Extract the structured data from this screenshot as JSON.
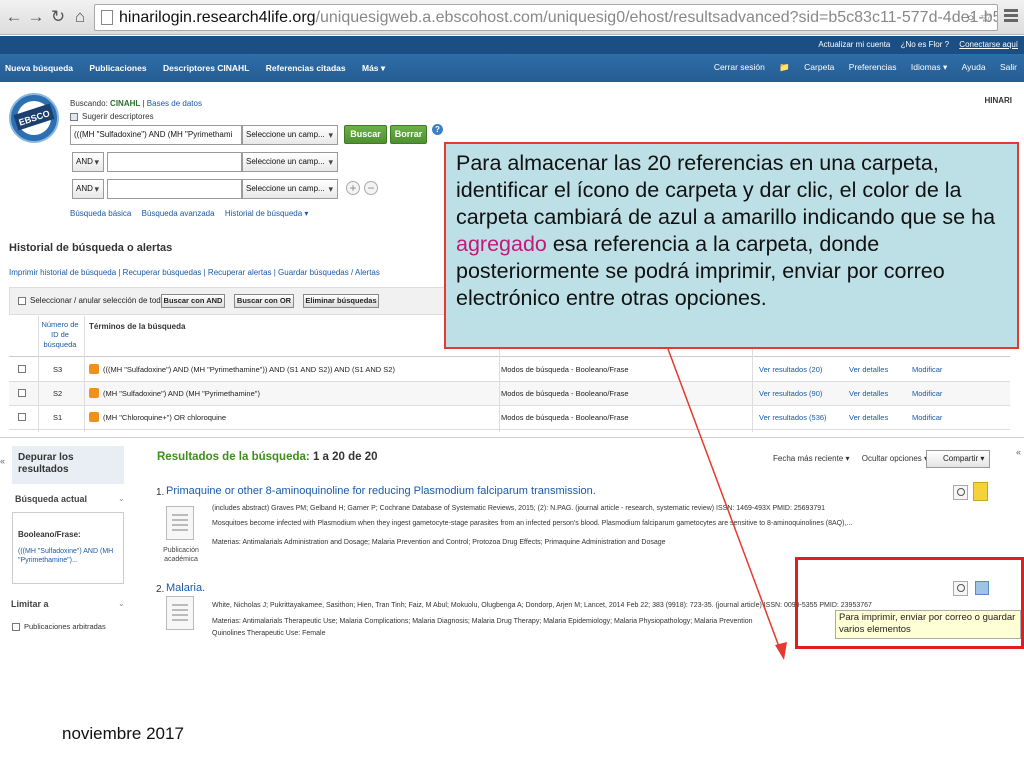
{
  "browser": {
    "url_host": "hinarilogin.research4life.org",
    "url_path": "/uniquesigweb.a.ebscohost.com/uniquesig0/ehost/resultsadvanced?sid=b5c83c11-577d-4de1-b5ca-078d830b3370%4...",
    "back_icon": "back-arrow-icon",
    "forward_icon": "forward-arrow-icon",
    "reload_icon": "reload-icon",
    "home_icon": "home-icon"
  },
  "topline": {
    "update_account": "Actualizar mi cuenta",
    "not_user": "¿No es Flor ?",
    "connect": "Conectarse aquí"
  },
  "nav": {
    "left": [
      "Nueva búsqueda",
      "Publicaciones",
      "Descriptores CINAHL",
      "Referencias citadas",
      "Más ▾"
    ],
    "right": [
      "Cerrar sesión",
      "Carpeta",
      "Preferencias",
      "Idiomas ▾",
      "Ayuda",
      "Salir"
    ]
  },
  "search": {
    "searching_label": "Buscando:",
    "database": "CINAHL",
    "databases_link": "Bases de datos",
    "suggest": "Sugerir descriptores",
    "row1_value": "(((MH \"Sulfadoxine\") AND (MH \"Pyrimethami",
    "field_select": "Seleccione un camp...",
    "bool_op": "AND",
    "search_button": "Buscar",
    "clear_button": "Borrar",
    "help": "?",
    "add": "+",
    "remove": "−",
    "links": [
      "Búsqueda básica",
      "Búsqueda avanzada",
      "Historial de búsqueda ▾"
    ],
    "hinari": "HINARI"
  },
  "history": {
    "title": "Historial de búsqueda o alertas",
    "links": "Imprimir historial de búsqueda | Recuperar búsquedas | Recuperar alertas | Guardar búsquedas / Alertas",
    "select_all": "Seleccionar / anular selección de todo",
    "btn_and": "Buscar con AND",
    "btn_or": "Buscar con OR",
    "btn_delete": "Eliminar búsquedas",
    "col_num": "Número de ID de búsqueda",
    "col_terms": "Términos de la búsqueda",
    "rows": [
      {
        "id": "S3",
        "query": "(((MH \"Sulfadoxine\") AND (MH \"Pyrimethamine\")) AND (S1 AND S2)) AND (S1 AND S2)",
        "mode": "Modos de búsqueda - Booleano/Frase",
        "results": "Ver resultados (20)",
        "details": "Ver detalles",
        "edit": "Modificar"
      },
      {
        "id": "S2",
        "query": "(MH \"Sulfadoxine\") AND (MH \"Pyrimethamine\")",
        "mode": "Modos de búsqueda - Booleano/Frase",
        "results": "Ver resultados (90)",
        "details": "Ver detalles",
        "edit": "Modificar"
      },
      {
        "id": "S1",
        "query": "(MH \"Chloroquine+\") OR chloroquine",
        "mode": "Modos de búsqueda - Booleano/Frase",
        "results": "Ver resultados (536)",
        "details": "Ver detalles",
        "edit": "Modificar"
      }
    ]
  },
  "sidebar": {
    "refine": "Depurar los resultados",
    "current": "Búsqueda actual",
    "bool_label": "Booleano/Frase:",
    "bool_value": "(((MH \"Sulfadoxine\") AND (MH \"Pyrimethamine\")...",
    "limit": "Limitar a",
    "peer": "Publicaciones arbitradas"
  },
  "results": {
    "title_label": "Resultados de la búsqueda:",
    "count": "1 a 20 de 20",
    "sort": "Fecha más reciente ▾",
    "hide": "Ocultar opciones ▾",
    "share": "Compartir ▾",
    "items": [
      {
        "num": "1.",
        "title": "Primaquine or other 8-aminoquinoline for reducing Plasmodium falciparum transmission.",
        "line1": "(includes abstract) Graves PM; Gelband H; Garner P; Cochrane Database of Systematic Reviews, 2015; (2): N.PAG. (journal article - research, systematic review) ISSN: 1469-493X PMID: 25693791",
        "line2": "Mosquitoes become infected with Plasmodium when they ingest gametocyte-stage parasites from an infected person's blood. Plasmodium falciparum gametocytes are sensitive to 8-aminoquinolines (8AQ),...",
        "line3": "Materias: Antimalarials Administration and Dosage; Malaria Prevention and Control; Protozoa Drug Effects; Primaquine Administration and Dosage",
        "pubtype": "Publicación académica"
      },
      {
        "num": "2.",
        "title": "Malaria.",
        "line1": "White, Nicholas J; Pukrittayakamee, Sasithon; Hien, Tran Tinh; Faiz, M Abul; Mokuolu, Olugbenga A; Dondorp, Arjen M; Lancet, 2014 Feb 22; 383 (9918): 723-35. (journal article) ISSN: 0099-5355 PMID: 23953767",
        "line2": "Materias: Antimalarials Therapeutic Use; Malaria Complications; Malaria Diagnosis; Malaria Drug Therapy; Malaria Epidemiology; Malaria Physiopathology; Malaria Prevention",
        "line3": "Quinolines Therapeutic Use: Female"
      }
    ]
  },
  "annotation": {
    "callout_before": "Para almacenar las 20 referencias en una carpeta, identificar el ícono de carpeta y dar clic, el color de la carpeta cambiará de azul a amarillo indicando que se ha ",
    "callout_highlight": "agregado",
    "callout_after": " esa referencia a la carpeta, donde posteriormente se podrá imprimir, enviar por correo electrónico entre otras opciones.",
    "tooltip": "Para imprimir, enviar por correo o guardar varios elementos",
    "highlight_color": "#c2187a",
    "arrow_color": "#e53a30"
  },
  "footer": "noviembre 2017"
}
